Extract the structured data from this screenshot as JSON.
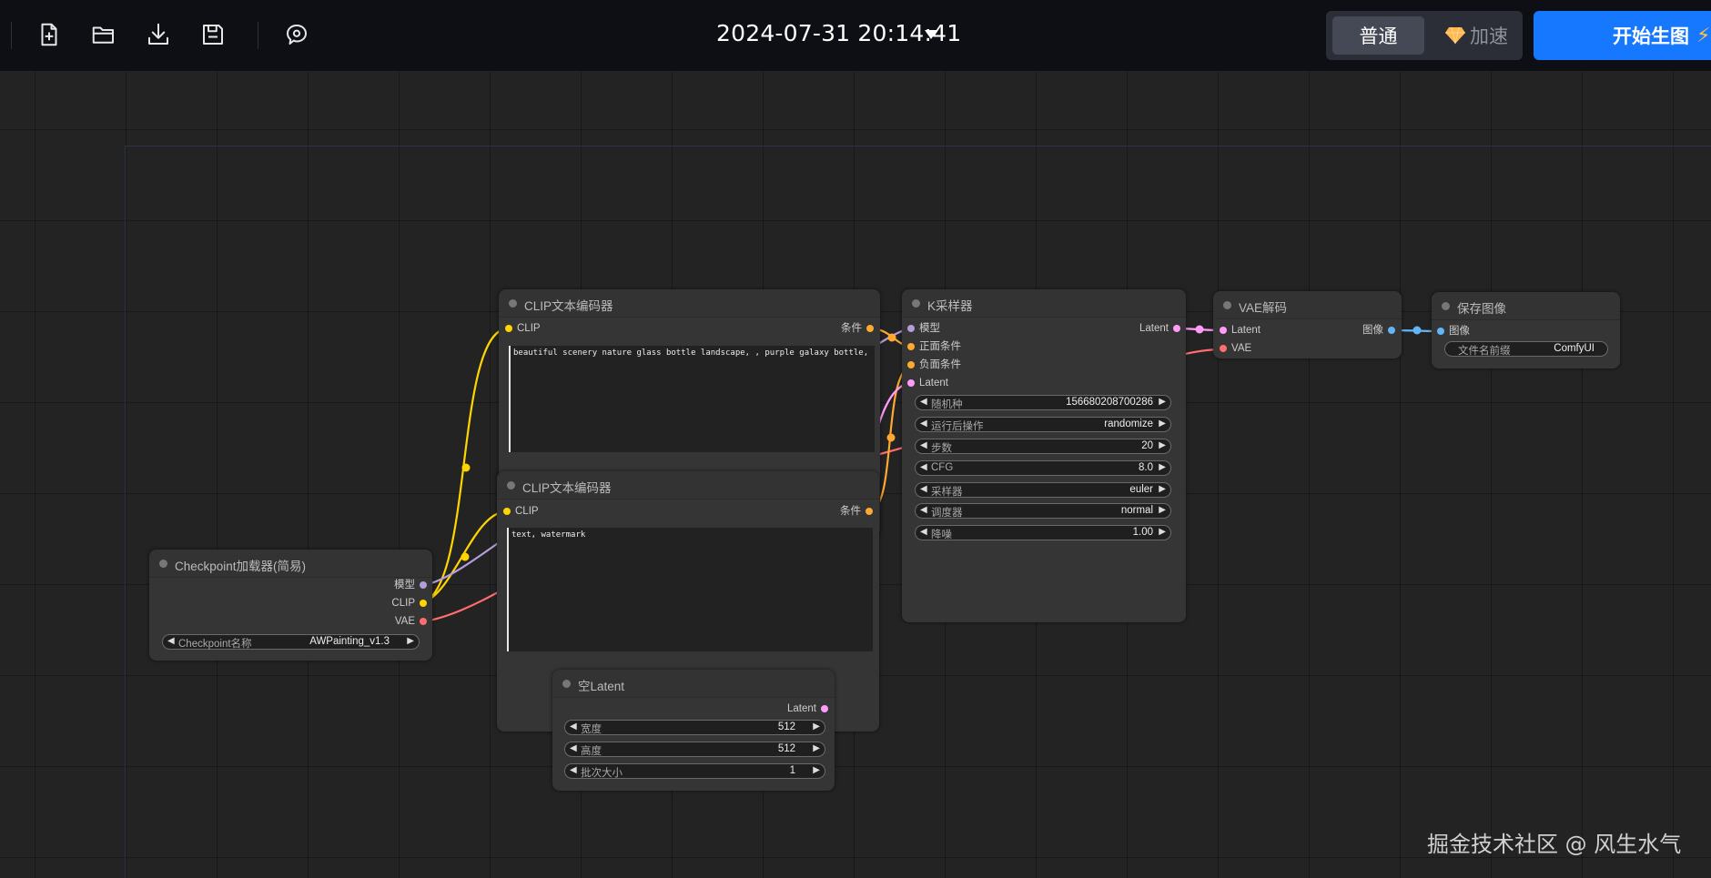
{
  "toolbar": {
    "icons": [
      "new-file-icon",
      "open-folder-icon",
      "download-icon",
      "save-icon",
      "model-icon"
    ],
    "datetime": "2024-07-31 20:14:41",
    "mode_normal": "普通",
    "mode_fast": "加速",
    "generate_label": "开始生图",
    "generate_icon": "lightning-icon",
    "accent": "#1677ff"
  },
  "nodes": {
    "clip_pos": {
      "title": "CLIP文本编码器",
      "input_clip": "CLIP",
      "output_cond": "条件",
      "text": "beautiful scenery nature glass bottle landscape, , purple galaxy bottle,"
    },
    "clip_neg": {
      "title": "CLIP文本编码器",
      "input_clip": "CLIP",
      "output_cond": "条件",
      "text": "text, watermark"
    },
    "ksampler": {
      "title": "K采样器",
      "inputs": [
        "模型",
        "正面条件",
        "负面条件",
        "Latent"
      ],
      "output": "Latent",
      "widgets": [
        {
          "label": "随机种",
          "value": "156680208700286"
        },
        {
          "label": "运行后操作",
          "value": "randomize"
        },
        {
          "label": "步数",
          "value": "20"
        },
        {
          "label": "CFG",
          "value": "8.0"
        },
        {
          "label": "采样器",
          "value": "euler"
        },
        {
          "label": "调度器",
          "value": "normal"
        },
        {
          "label": "降噪",
          "value": "1.00"
        }
      ]
    },
    "vae_decode": {
      "title": "VAE解码",
      "inputs": [
        "Latent",
        "VAE"
      ],
      "output": "图像"
    },
    "save_image": {
      "title": "保存图像",
      "input": "图像",
      "widget": {
        "label": "文件名前缀",
        "value": "ComfyUI"
      }
    },
    "checkpoint": {
      "title": "Checkpoint加载器(简易)",
      "outputs": [
        "模型",
        "CLIP",
        "VAE"
      ],
      "widget": {
        "label": "Checkpoint名称",
        "value": "AWPainting_v1.3"
      }
    },
    "empty_latent": {
      "title": "空Latent",
      "output": "Latent",
      "widgets": [
        {
          "label": "宽度",
          "value": "512"
        },
        {
          "label": "高度",
          "value": "512"
        },
        {
          "label": "批次大小",
          "value": "1"
        }
      ]
    }
  },
  "slot_colors": {
    "model": "#b39ddb",
    "clip": "#ffd500",
    "vae": "#ff6e6e",
    "conditioning": "#ffa931",
    "latent": "#ff9cf9",
    "image": "#64b5f6"
  },
  "watermark": "掘金技术社区 @ 风生水气"
}
